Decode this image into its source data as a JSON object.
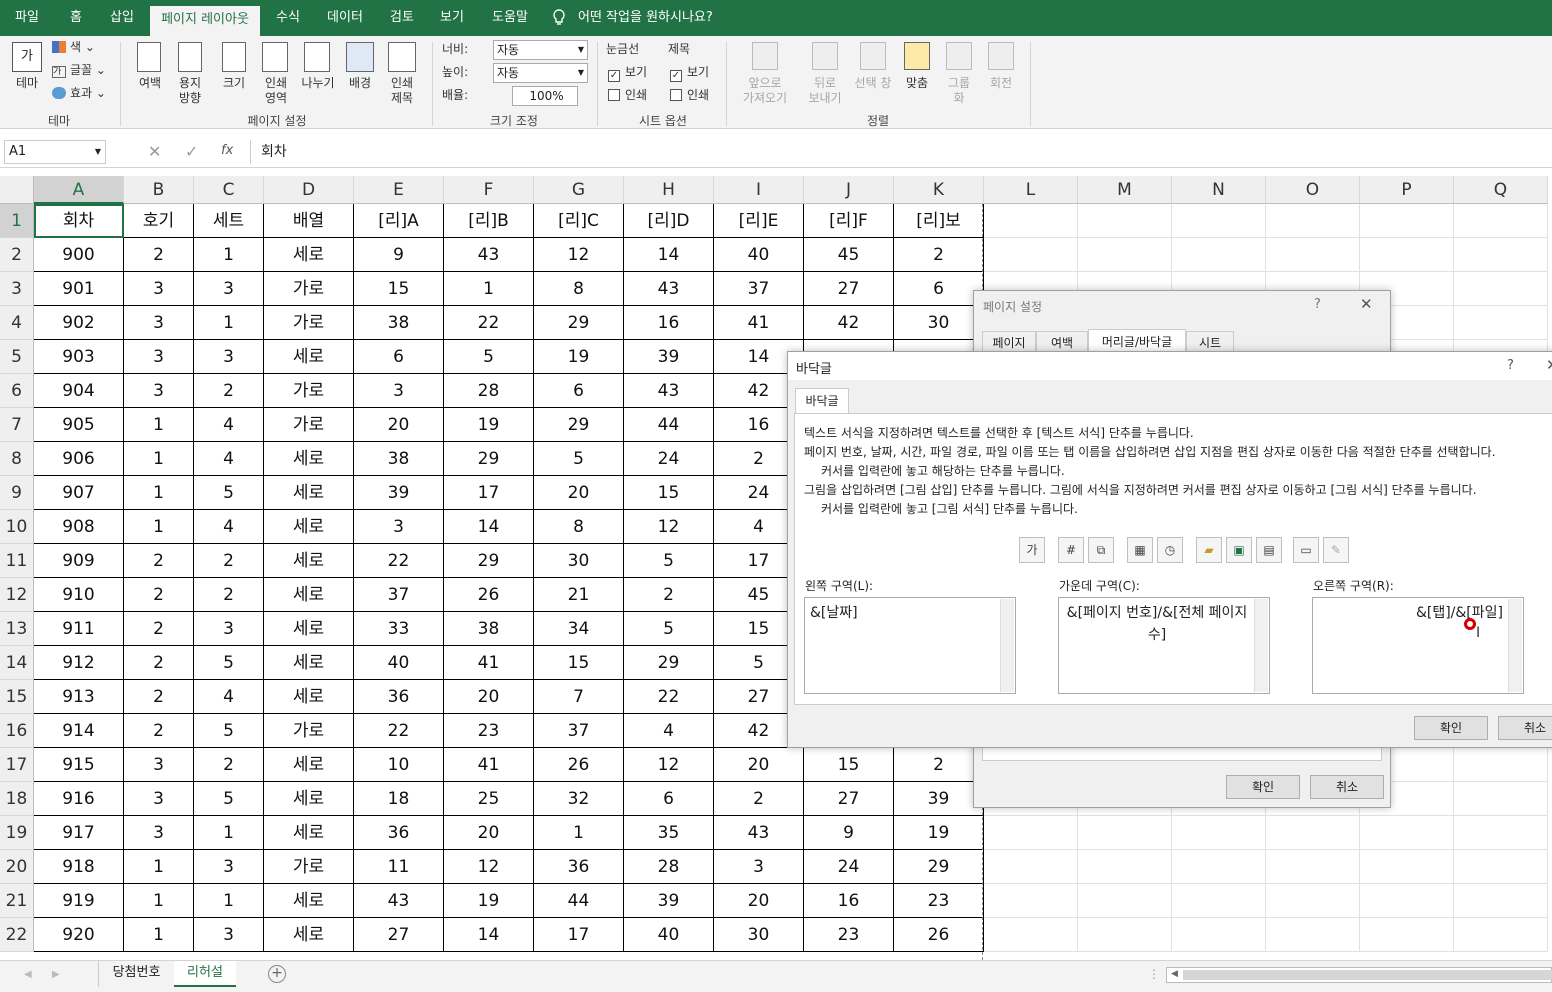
{
  "ribbon_tabs": [
    "파일",
    "홈",
    "삽입",
    "페이지 레이아웃",
    "수식",
    "데이터",
    "검토",
    "보기",
    "도움말"
  ],
  "tell_me": "어떤 작업을 원하시나요?",
  "ribbon": {
    "theme": {
      "theme_label": "테마",
      "colors": "색",
      "fonts": "글꼴",
      "effects": "효과",
      "group": "테마"
    },
    "page_setup": {
      "margins": "여백",
      "orientation": "용지\n방향",
      "size": "크기",
      "print_area": "인쇄\n영역",
      "breaks": "나누기",
      "background": "배경",
      "print_titles": "인쇄\n제목",
      "group": "페이지 설정"
    },
    "scale": {
      "width_label": "너비:",
      "width_value": "자동",
      "height_label": "높이:",
      "height_value": "자동",
      "scale_label": "배율:",
      "scale_value": "100%",
      "group": "크기 조정"
    },
    "sheet_options": {
      "gridlines": "눈금선",
      "headings": "제목",
      "view": "보기",
      "print": "인쇄",
      "group": "시트 옵션"
    },
    "arrange": {
      "bring_forward": "앞으로\n가져오기",
      "send_backward": "뒤로\n보내기",
      "selection_pane": "선택 창",
      "align": "맞춤",
      "group_btn": "그룹\n화",
      "rotate": "회전",
      "group": "정렬"
    }
  },
  "formula_bar": {
    "name_box": "A1",
    "fx": "fx",
    "formula": "회차"
  },
  "columns": [
    "A",
    "B",
    "C",
    "D",
    "E",
    "F",
    "G",
    "H",
    "I",
    "J",
    "K",
    "L",
    "M",
    "N",
    "O",
    "P",
    "Q"
  ],
  "header_row": [
    "회차",
    "호기",
    "세트",
    "배열",
    "[리]A",
    "[리]B",
    "[리]C",
    "[리]D",
    "[리]E",
    "[리]F",
    "[리]보"
  ],
  "rows": [
    [
      "900",
      "2",
      "1",
      "세로",
      "9",
      "43",
      "12",
      "14",
      "40",
      "45",
      "2"
    ],
    [
      "901",
      "3",
      "3",
      "가로",
      "15",
      "1",
      "8",
      "43",
      "37",
      "27",
      "6"
    ],
    [
      "902",
      "3",
      "1",
      "가로",
      "38",
      "22",
      "29",
      "16",
      "41",
      "42",
      "30"
    ],
    [
      "903",
      "3",
      "3",
      "세로",
      "6",
      "5",
      "19",
      "39",
      "14",
      "",
      ""
    ],
    [
      "904",
      "3",
      "2",
      "가로",
      "3",
      "28",
      "6",
      "43",
      "42",
      "",
      ""
    ],
    [
      "905",
      "1",
      "4",
      "가로",
      "20",
      "19",
      "29",
      "44",
      "16",
      "",
      ""
    ],
    [
      "906",
      "1",
      "4",
      "세로",
      "38",
      "29",
      "5",
      "24",
      "2",
      "",
      ""
    ],
    [
      "907",
      "1",
      "5",
      "세로",
      "39",
      "17",
      "20",
      "15",
      "24",
      "",
      ""
    ],
    [
      "908",
      "1",
      "4",
      "세로",
      "3",
      "14",
      "8",
      "12",
      "4",
      "",
      ""
    ],
    [
      "909",
      "2",
      "2",
      "세로",
      "22",
      "29",
      "30",
      "5",
      "17",
      "",
      ""
    ],
    [
      "910",
      "2",
      "2",
      "세로",
      "37",
      "26",
      "21",
      "2",
      "45",
      "",
      ""
    ],
    [
      "911",
      "2",
      "3",
      "세로",
      "33",
      "38",
      "34",
      "5",
      "15",
      "",
      ""
    ],
    [
      "912",
      "2",
      "5",
      "세로",
      "40",
      "41",
      "15",
      "29",
      "5",
      "",
      ""
    ],
    [
      "913",
      "2",
      "4",
      "세로",
      "36",
      "20",
      "7",
      "22",
      "27",
      "",
      ""
    ],
    [
      "914",
      "2",
      "5",
      "가로",
      "22",
      "23",
      "37",
      "4",
      "42",
      "",
      ""
    ],
    [
      "915",
      "3",
      "2",
      "세로",
      "10",
      "41",
      "26",
      "12",
      "20",
      "15",
      "2"
    ],
    [
      "916",
      "3",
      "5",
      "세로",
      "18",
      "25",
      "32",
      "6",
      "2",
      "27",
      "39"
    ],
    [
      "917",
      "3",
      "1",
      "세로",
      "36",
      "20",
      "1",
      "35",
      "43",
      "9",
      "19"
    ],
    [
      "918",
      "1",
      "3",
      "가로",
      "11",
      "12",
      "36",
      "28",
      "3",
      "24",
      "29"
    ],
    [
      "919",
      "1",
      "1",
      "세로",
      "43",
      "19",
      "44",
      "39",
      "20",
      "16",
      "23"
    ],
    [
      "920",
      "1",
      "3",
      "세로",
      "27",
      "14",
      "17",
      "40",
      "30",
      "23",
      "26"
    ]
  ],
  "row_numbers": [
    "1",
    "2",
    "3",
    "4",
    "5",
    "6",
    "7",
    "8",
    "9",
    "10",
    "11",
    "12",
    "13",
    "14",
    "15",
    "16",
    "17",
    "18",
    "19",
    "20",
    "21",
    "22"
  ],
  "sheet_tabs": [
    "당첨번호",
    "리허설"
  ],
  "page_setup_dialog": {
    "title": "페이지 설정",
    "help": "?",
    "tabs": [
      "페이지",
      "여백",
      "머리글/바닥글",
      "시트"
    ],
    "ok": "확인",
    "cancel": "취소"
  },
  "footer_dialog": {
    "title": "바닥글",
    "help": "?",
    "tab": "바닥글",
    "instructions": [
      "텍스트 서식을 지정하려면 텍스트를 선택한 후 [텍스트 서식] 단추를 누릅니다.",
      "페이지 번호, 날짜, 시간, 파일 경로, 파일 이름 또는 탭 이름을 삽입하려면 삽입 지점을 편집 상자로 이동한 다음 적절한 단추를 선택합니다.",
      "커서를 입력란에 놓고 해당하는 단추를 누릅니다.",
      "그림을 삽입하려면 [그림 삽입] 단추를 누릅니다.  그림에 서식을 지정하려면 커서를 편집 상자로 이동하고 [그림 서식] 단추를 누릅니다.",
      "커서를 입력란에 놓고 [그림 서식] 단추를 누릅니다."
    ],
    "format_text_btn": "가",
    "left_label": "왼쪽 구역(L):",
    "left_value": "&[날짜]",
    "center_label": "가운데 구역(C):",
    "center_value": "&[페이지 번호]/&[전체 페이지 수]",
    "right_label": "오른쪽 구역(R):",
    "right_value": "&[탭]/&[파일]",
    "ok": "확인",
    "cancel": "취소"
  }
}
